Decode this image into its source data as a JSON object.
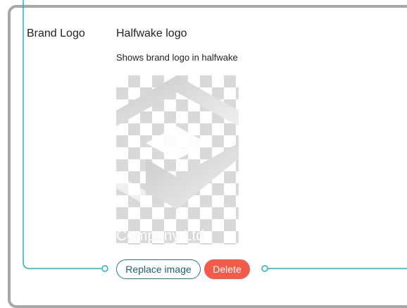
{
  "section": {
    "label": "Brand Logo"
  },
  "setting": {
    "title": "Halfwake logo",
    "description": "Shows brand logo in halfwake"
  },
  "preview": {
    "caption": "Company Ltd"
  },
  "buttons": {
    "replace_label": "Replace image",
    "delete_label": "Delete"
  },
  "colors": {
    "accent": "#1fb5c4",
    "delete": "#f25b4a",
    "panel_border": "#a8a8a8"
  }
}
